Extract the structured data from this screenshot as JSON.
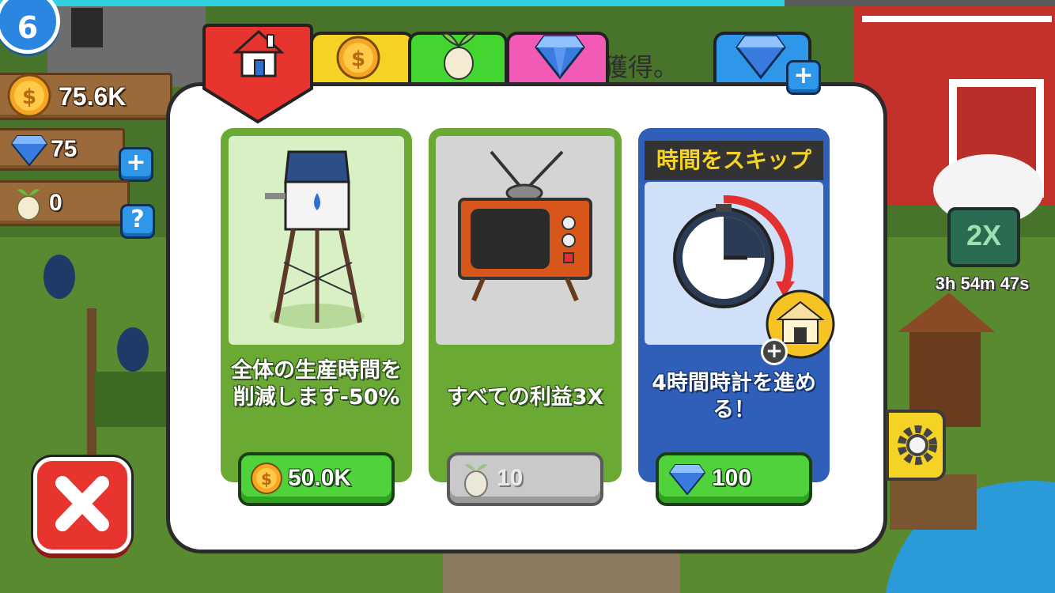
{
  "hud": {
    "level": "6",
    "coins": "75.6K",
    "gems": "75",
    "seeds": "0",
    "add_gems_icon": "plus-icon",
    "help_label": "?"
  },
  "background": {
    "partial_text": "獲得。",
    "boost_label": "2X",
    "boost_timer": "3h 54m 47s"
  },
  "tabs": [
    {
      "name": "house",
      "icon": "house-icon",
      "color": "#e8342e",
      "active": true
    },
    {
      "name": "coins",
      "icon": "coin-icon",
      "color": "#f5d325",
      "active": false
    },
    {
      "name": "seeds",
      "icon": "seed-icon",
      "color": "#43d630",
      "active": false
    },
    {
      "name": "gems",
      "icon": "gem-icon",
      "color": "#f25ab5",
      "active": false
    },
    {
      "name": "buy-gems",
      "icon": "gem-plus-icon",
      "color": "#2f97ea",
      "active": false
    }
  ],
  "cards": [
    {
      "item": "water-tower",
      "description": "全体の生産時間を削減します-50%",
      "currency_icon": "coin-icon",
      "price": "50.0K",
      "enabled": true
    },
    {
      "item": "television",
      "description": "すべての利益3X",
      "currency_icon": "seed-icon",
      "price": "10",
      "enabled": false
    },
    {
      "item": "stopwatch",
      "header": "時間をスキップ",
      "description": "4時間時計を進める！",
      "currency_icon": "gem-icon",
      "price": "100",
      "enabled": true
    }
  ],
  "colors": {
    "green_card": "#6aaa34",
    "blue_card": "#2f5fb8",
    "button_green": "#4fd23a",
    "close_red": "#e8342e"
  }
}
